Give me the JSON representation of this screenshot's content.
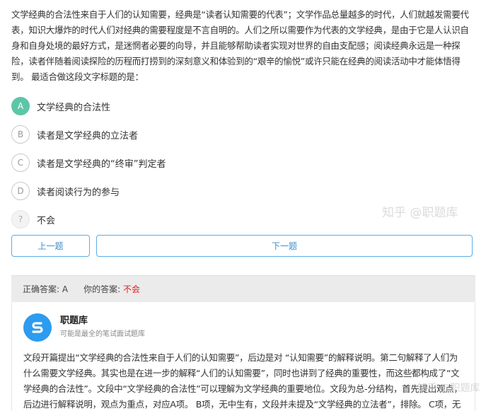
{
  "question": {
    "text": "文学经典的合法性来自于人们的认知需要，经典是“读者认知需要的代表”；文学作品总量越多的时代，人们就越发需要代表，知识大爆炸的时代人们对经典的需要程度是不言自明的。人们之所以需要作为代表的文学经典，是由于它是人认识自身和自身处境的最好方式，是迷惘者必要的向导，并且能够帮助读者实现对世界的自由支配感；阅读经典永远是一种探险，读者伴随着阅读探险的历程而打捞到的深刻意义和体验到的“艰辛的愉悦”或许只能在经典的阅读活动中才能体悟得到。 最适合做这段文字标题的是："
  },
  "options": [
    {
      "letter": "A",
      "text": "文学经典的合法性",
      "state": "correct"
    },
    {
      "letter": "B",
      "text": "读者是文学经典的立法者",
      "state": "normal"
    },
    {
      "letter": "C",
      "text": "读者是文学经典的“终审”判定者",
      "state": "normal"
    },
    {
      "letter": "D",
      "text": "读者阅读行为的参与",
      "state": "normal"
    },
    {
      "letter": "?",
      "text": "不会",
      "state": "unknown"
    }
  ],
  "nav": {
    "prev_label": "上一题",
    "next_label": "下一题"
  },
  "answer": {
    "correct_label": "正确答案: A",
    "your_label": "你的答案:",
    "your_value": "不会"
  },
  "explanation": {
    "brand_name": "职题库",
    "brand_tagline": "可能是最全的笔试面试题库",
    "text": "文段开篇提出“文学经典的合法性来自于人们的认知需要”，后边是对 “认知需要”的解释说明。第二句解释了人们为什么需要文学经典。其实也是在进一步的解释“人们的认知需要”，同时也讲到了经典的重要性，而这些都构成了“文学经典的合法性”。文段中“文学经典的合法性”可以理解为文学经典的重要地位。文段为总-分结构，首先提出观点，后边进行解释说明，观点为重点，对应A项。 B项，无中生有，文段并未提及“文学经典的立法者”，排除。 C项，无中生有，文"
  },
  "watermarks": {
    "main": "知乎 @职题库",
    "corner": "知乎 @职题库"
  },
  "colors": {
    "correct": "#5cc6a6",
    "accent_blue": "#3a8fd0",
    "wrong_red": "#e02020",
    "brand_blue": "#2d9bef"
  }
}
